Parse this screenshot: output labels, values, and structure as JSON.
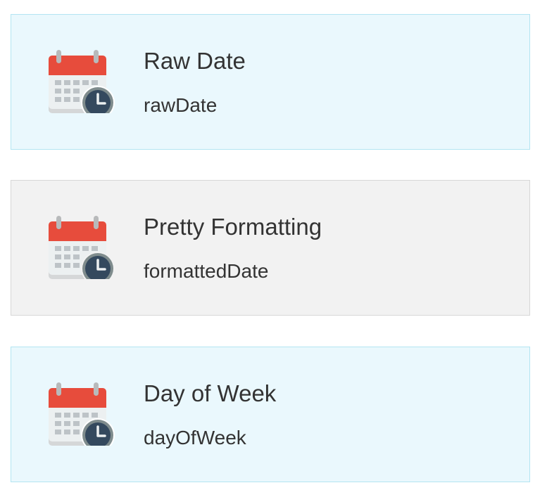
{
  "cards": [
    {
      "title": "Raw Date",
      "subtitle": "rawDate",
      "icon": "calendar-clock-icon",
      "selected": false
    },
    {
      "title": "Pretty Formatting",
      "subtitle": "formattedDate",
      "icon": "calendar-clock-icon",
      "selected": true
    },
    {
      "title": "Day of Week",
      "subtitle": "dayOfWeek",
      "icon": "calendar-clock-icon",
      "selected": false
    }
  ],
  "colors": {
    "card_background": "#eaf8fd",
    "card_border": "#b3e5f2",
    "selected_background": "#f2f2f2",
    "selected_border": "#d7d7d7",
    "calendar_header": "#e74c3c",
    "clock_face": "#34495e"
  }
}
